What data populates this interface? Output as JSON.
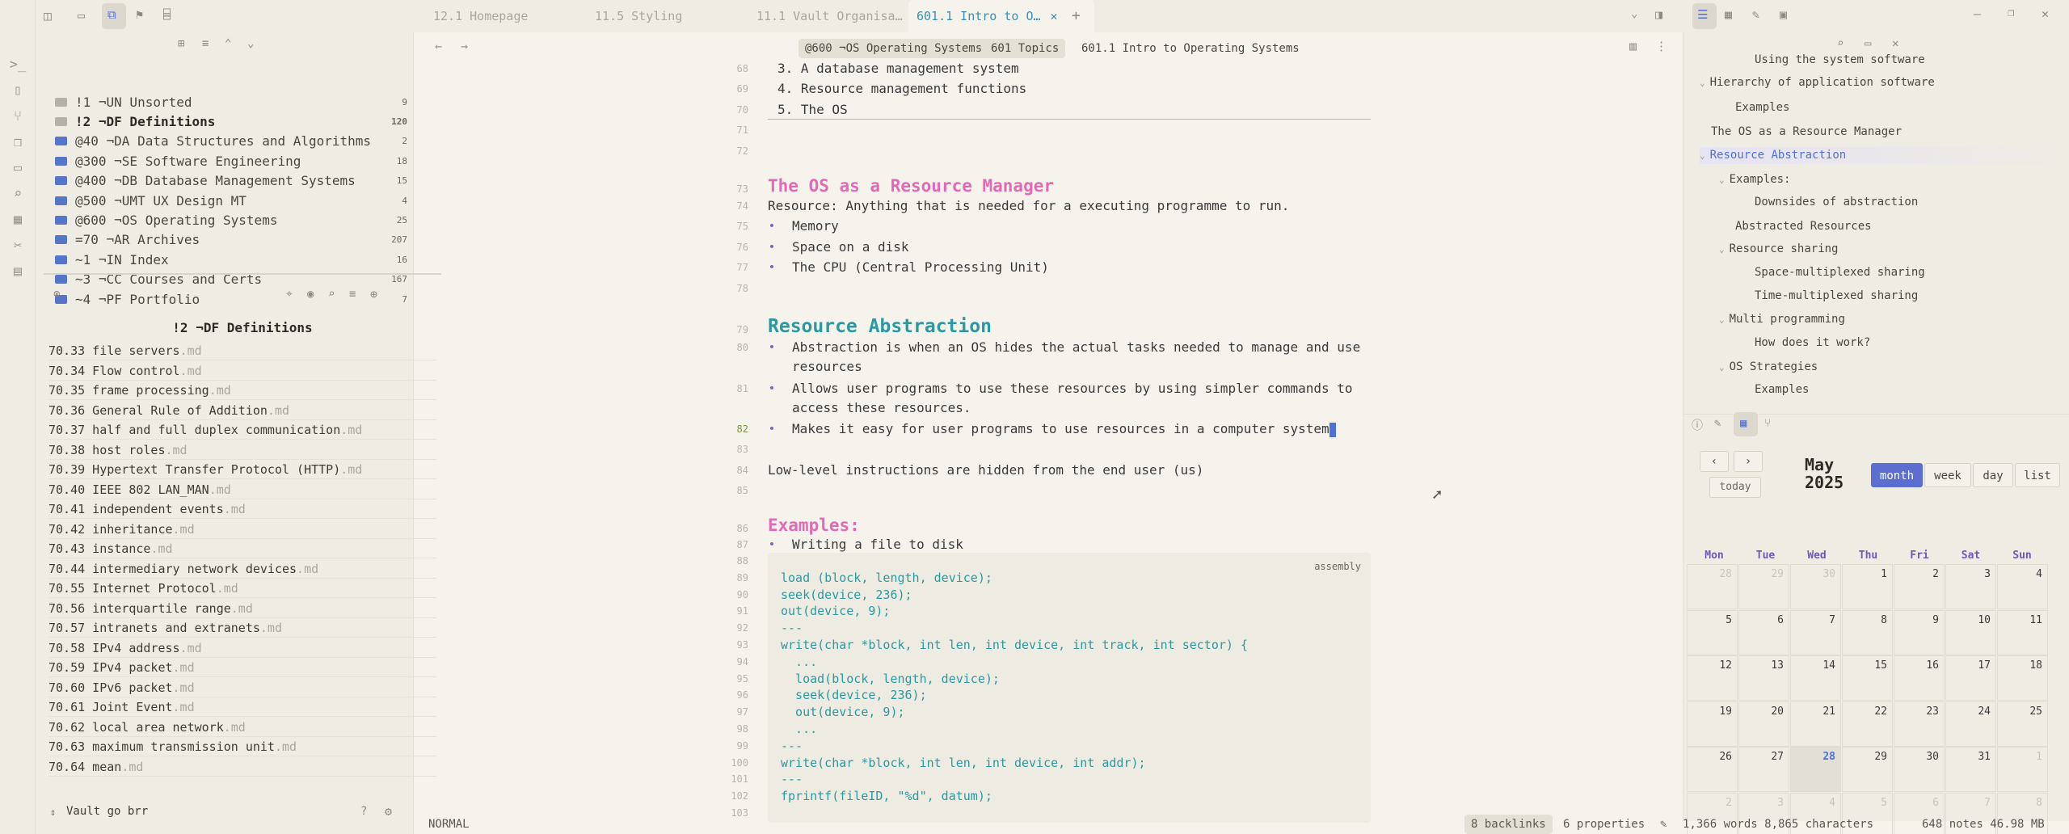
{
  "tabs": [
    "12.1 Homepage",
    "11.5 Styling",
    "11.1 Vault Organisa…",
    "601.1 Intro to O…"
  ],
  "breadcrumb": [
    "@600 ¬OS Operating Systems",
    "601 Topics",
    "601.1 Intro to Operating Systems"
  ],
  "folders": [
    {
      "name": "!1 ¬UN Unsorted",
      "count": "9",
      "blue": false
    },
    {
      "name": "!2 ¬DF Definitions",
      "count": "120",
      "blue": false,
      "selected": true
    },
    {
      "name": "@40 ¬DA Data Structures and Algorithms",
      "count": "2",
      "blue": true
    },
    {
      "name": "@300 ¬SE Software Engineering",
      "count": "18",
      "blue": true
    },
    {
      "name": "@400 ¬DB Database Management Systems",
      "count": "15",
      "blue": true
    },
    {
      "name": "@500 ¬UMT UX Design MT",
      "count": "4",
      "blue": true
    },
    {
      "name": "@600 ¬OS Operating Systems",
      "count": "25",
      "blue": true
    },
    {
      "name": "=70 ¬AR Archives",
      "count": "207",
      "blue": true
    },
    {
      "name": "~1 ¬IN Index",
      "count": "16",
      "blue": true
    },
    {
      "name": "~3 ¬CC Courses and Certs",
      "count": "167",
      "blue": true
    },
    {
      "name": "~4 ¬PF Portfolio",
      "count": "7",
      "blue": true
    }
  ],
  "notes_title": "!2 ¬DF Definitions",
  "notes": [
    "70.33 file servers",
    "70.34 Flow control",
    "70.35 frame processing",
    "70.36 General Rule of Addition",
    "70.37 half and full duplex communication",
    "70.38 host roles",
    "70.39 Hypertext Transfer Protocol (HTTP)",
    "70.40 IEEE 802 LAN_MAN",
    "70.41 independent events",
    "70.42 inheritance",
    "70.43 instance",
    "70.44 intermediary network devices",
    "70.55 Internet Protocol",
    "70.56 interquartile range",
    "70.57 intranets and extranets",
    "70.58 IPv4 address",
    "70.59 IPv4 packet",
    "70.60 IPv6 packet",
    "70.61 Joint Event",
    "70.62 local area network",
    "70.63 maximum transmission unit",
    "70.64 mean"
  ],
  "note_ext": ".md",
  "vault_name": "Vault go brr",
  "editor_lines": [
    {
      "n": "68",
      "t": "3. A database management system",
      "k": "ol"
    },
    {
      "n": "69",
      "t": "4. Resource management functions",
      "k": "ol"
    },
    {
      "n": "70",
      "t": "5. The OS",
      "k": "ol"
    },
    {
      "n": "71",
      "t": "",
      "k": "p"
    },
    {
      "n": "72",
      "t": "",
      "k": "p"
    },
    {
      "n": "73",
      "t": "The OS as a Resource Manager",
      "k": "h2"
    },
    {
      "n": "74",
      "t": "Resource: Anything that is needed for a executing programme to run.",
      "k": "p"
    },
    {
      "n": "75",
      "t": "Memory",
      "k": "li"
    },
    {
      "n": "76",
      "t": "Space on a disk",
      "k": "li"
    },
    {
      "n": "77",
      "t": "The CPU (Central Processing Unit)",
      "k": "li"
    },
    {
      "n": "78",
      "t": "",
      "k": "p"
    },
    {
      "n": "79",
      "t": "Resource Abstraction",
      "k": "h1"
    },
    {
      "n": "80",
      "t": "Abstraction is when an OS hides the actual tasks needed to manage and use",
      "t2": "resources",
      "k": "li2"
    },
    {
      "n": "81",
      "t": "Allows user programs to use these resources by using simpler commands to",
      "t2": "access these resources.",
      "k": "li2"
    },
    {
      "n": "82",
      "t": "Makes it easy for user programs to use resources in a computer system",
      "k": "licur"
    },
    {
      "n": "83",
      "t": "",
      "k": "p"
    },
    {
      "n": "84",
      "t": "Low-level instructions are hidden from the end user (us)",
      "k": "p"
    },
    {
      "n": "85",
      "t": "",
      "k": "p"
    },
    {
      "n": "86",
      "t": "Examples:",
      "k": "h2"
    },
    {
      "n": "87",
      "t": "Writing a file to disk",
      "k": "li"
    }
  ],
  "code_lang": "assembly",
  "code_lines": [
    {
      "n": "88",
      "t": ""
    },
    {
      "n": "89",
      "t": "load (block, length, device);"
    },
    {
      "n": "90",
      "t": "seek(device, 236);"
    },
    {
      "n": "91",
      "t": "out(device, 9);"
    },
    {
      "n": "92",
      "t": "---"
    },
    {
      "n": "93",
      "t": "write(char *block, int len, int device, int track, int sector) {"
    },
    {
      "n": "94",
      "t": "  ..."
    },
    {
      "n": "95",
      "t": "  load(block, length, device);"
    },
    {
      "n": "96",
      "t": "  seek(device, 236);"
    },
    {
      "n": "97",
      "t": "  out(device, 9);"
    },
    {
      "n": "98",
      "t": "  ..."
    },
    {
      "n": "99",
      "t": "---"
    },
    {
      "n": "100",
      "t": "write(char *block, int len, int device, int addr);"
    },
    {
      "n": "101",
      "t": "---"
    },
    {
      "n": "102",
      "t": "fprintf(fileID, \"%d\", datum);"
    },
    {
      "n": "103",
      "t": ""
    }
  ],
  "outline": [
    {
      "t": "Using the system software",
      "lvl": 2,
      "ch": false
    },
    {
      "t": "Hierarchy of application software",
      "lvl": 0,
      "ch": true
    },
    {
      "t": "Examples",
      "lvl": 1,
      "ch": false
    },
    {
      "t": "The OS as a Resource Manager",
      "lvl": 0,
      "ch": false,
      "flat": true
    },
    {
      "t": "Resource Abstraction",
      "lvl": 0,
      "ch": true,
      "active": true
    },
    {
      "t": "Examples:",
      "lvl": 1,
      "ch": true
    },
    {
      "t": "Downsides of abstraction",
      "lvl": 2,
      "ch": false
    },
    {
      "t": "Abstracted Resources",
      "lvl": 1,
      "ch": false
    },
    {
      "t": "Resource sharing",
      "lvl": 1,
      "ch": true
    },
    {
      "t": "Space-multiplexed sharing",
      "lvl": 2,
      "ch": false
    },
    {
      "t": "Time-multiplexed sharing",
      "lvl": 2,
      "ch": false
    },
    {
      "t": "Multi programming",
      "lvl": 1,
      "ch": true
    },
    {
      "t": "How does it work?",
      "lvl": 2,
      "ch": false
    },
    {
      "t": "OS Strategies",
      "lvl": 1,
      "ch": true
    },
    {
      "t": "Examples",
      "lvl": 2,
      "ch": false
    }
  ],
  "calendar": {
    "month": "May",
    "year": "2025",
    "today_label": "today",
    "views": [
      "month",
      "week",
      "day",
      "list"
    ],
    "dow": [
      "Mon",
      "Tue",
      "Wed",
      "Thu",
      "Fri",
      "Sat",
      "Sun"
    ],
    "weeks": [
      [
        "28",
        "29",
        "30",
        "1",
        "2",
        "3",
        "4"
      ],
      [
        "5",
        "6",
        "7",
        "8",
        "9",
        "10",
        "11"
      ],
      [
        "12",
        "13",
        "14",
        "15",
        "16",
        "17",
        "18"
      ],
      [
        "19",
        "20",
        "21",
        "22",
        "23",
        "24",
        "25"
      ],
      [
        "26",
        "27",
        "28",
        "29",
        "30",
        "31",
        "1"
      ],
      [
        "2",
        "3",
        "4",
        "5",
        "6",
        "7",
        "8"
      ]
    ],
    "today": "28"
  },
  "status": {
    "mode": "NORMAL",
    "backlinks": "8 backlinks",
    "properties": "6 properties",
    "words": "1,366 words 8,865 characters",
    "notes": "648 notes 46.98 MB"
  }
}
